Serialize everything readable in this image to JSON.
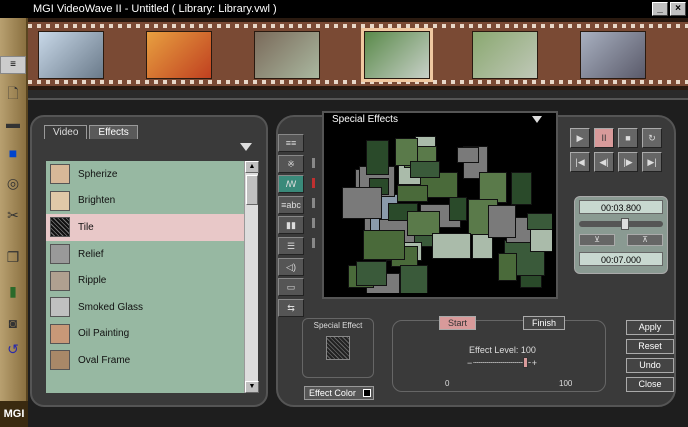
{
  "window": {
    "title": "MGI VideoWave II - Untitled ( Library: Library.vwl )"
  },
  "left_toolbar": {
    "menu_tab": "≡",
    "logo": "MGI",
    "tools": [
      "page-icon",
      "folder-icon",
      "save-icon",
      "film-reel-icon",
      "scissors-icon",
      "copy-icon",
      "battery-icon",
      "disk-icon",
      "undo-icon"
    ]
  },
  "filmstrip": {
    "frames": [
      {
        "colors": [
          "#c8d8e8",
          "#6a7a8a"
        ]
      },
      {
        "colors": [
          "#e8a040",
          "#c04020"
        ]
      },
      {
        "colors": [
          "#7a6a5a",
          "#aab8a0"
        ]
      },
      {
        "colors": [
          "#5a8a4a",
          "#c8d0c8"
        ],
        "selected": true
      },
      {
        "colors": [
          "#8aa870",
          "#c0c8b8"
        ]
      },
      {
        "colors": [
          "#a8b0c0",
          "#5a5a6a"
        ]
      }
    ]
  },
  "library": {
    "tabs": [
      "Video",
      "Effects"
    ],
    "active_tab": "Effects",
    "effects": [
      {
        "name": "Spherize",
        "thumb": "#d8b898"
      },
      {
        "name": "Brighten",
        "thumb": "#e0c8a8"
      },
      {
        "name": "Tile",
        "thumb": "#222222",
        "selected": true
      },
      {
        "name": "Relief",
        "thumb": "#999999"
      },
      {
        "name": "Ripple",
        "thumb": "#b0a090"
      },
      {
        "name": "Smoked Glass",
        "thumb": "#c0c0c0"
      },
      {
        "name": "Oil Painting",
        "thumb": "#c89878"
      },
      {
        "name": "Oval Frame",
        "thumb": "#a88868"
      }
    ]
  },
  "preview": {
    "title": "Special Effects"
  },
  "side_tools": [
    "≡≡",
    "※",
    "ꟿ",
    "≡abc",
    "▮▮",
    "☰",
    "◁)",
    "▭",
    "⇆"
  ],
  "playback": {
    "row1": [
      "▶",
      "II",
      "■",
      "↻"
    ],
    "row2": [
      "|◀",
      "◀|",
      "|▶",
      "▶|"
    ],
    "start_time": "00:03.800",
    "end_time": "00:07.000",
    "mark_in": "⊻",
    "mark_out": "⊼",
    "position": 0.55
  },
  "special_effect": {
    "label": "Special Effect",
    "color_button": "Effect Color"
  },
  "timing": {
    "start": "Start",
    "finish": "Finish",
    "effect_level_label": "Effect Level:",
    "effect_level_value": "100",
    "min": "0",
    "max": "100",
    "minus": "−",
    "plus": "+",
    "level": 1.0
  },
  "actions": [
    "Apply",
    "Reset",
    "Undo",
    "Close"
  ],
  "colors": {
    "list_bg": "#97b8a2",
    "selected_row": "#e8c8c8",
    "film": "#7a4a34",
    "time_panel": "#8a9a92"
  }
}
